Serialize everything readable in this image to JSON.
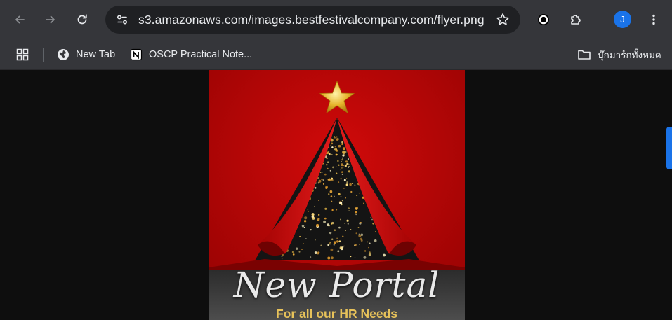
{
  "browser": {
    "url": "s3.amazonaws.com/images.bestfestivalcompany.com/flyer.png",
    "profile_initial": "J"
  },
  "bookmarks": {
    "items": [
      {
        "label": "New Tab",
        "icon": "globe-icon"
      },
      {
        "label": "OSCP Practical Note...",
        "icon": "notion-icon"
      }
    ],
    "all_bookmarks_label": "บุ๊กมาร์กทั้งหมด"
  },
  "flyer": {
    "title": "New Portal",
    "subtitle": "For all our HR Needs"
  },
  "colors": {
    "toolbar": "#35363a",
    "omnibox": "#1f2023",
    "page_background": "#0e0e0e",
    "flyer_red": "#b40505",
    "accent_blue": "#1a73e8"
  }
}
